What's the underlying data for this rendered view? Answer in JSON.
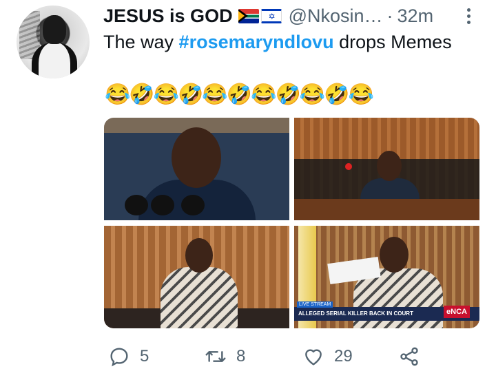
{
  "tweet": {
    "display_name": "JESUS is GOD",
    "flags": [
      "south-africa-flag",
      "israel-flag"
    ],
    "handle": "@Nkosin…",
    "separator": "·",
    "time": "32m",
    "text_before": "The way ",
    "hashtag": "#rosemaryndlovu",
    "text_after": " drops Memes",
    "emoji_line": "😂🤣😂🤣😂🤣😂🤣😂🤣😂"
  },
  "media": {
    "news_tag": "LIVE STREAM",
    "ticker": "ALLEGED SERIAL KILLER BACK IN COURT",
    "channel_logo": "eNCA"
  },
  "actions": {
    "reply_count": "5",
    "retweet_count": "8",
    "like_count": "29"
  },
  "colors": {
    "hashtag": "#1d9bf0",
    "secondary_text": "#536471",
    "primary_text": "#0f1419"
  }
}
